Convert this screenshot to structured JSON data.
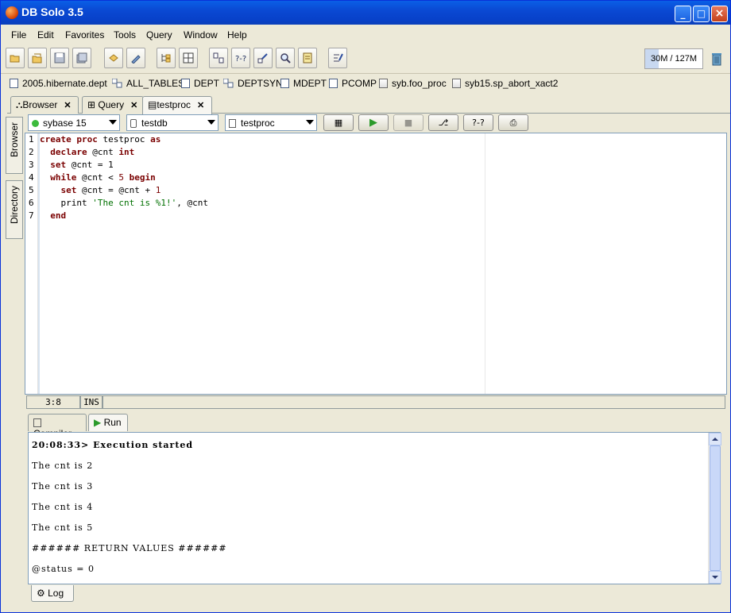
{
  "window": {
    "title": "DB Solo  3.5"
  },
  "menu": [
    "File",
    "Edit",
    "Favorites",
    "Tools",
    "Query",
    "Window",
    "Help"
  ],
  "memory": {
    "label": "30M / 127M",
    "used_fraction": 0.24
  },
  "favorites": [
    {
      "label": "2005.hibernate.dept",
      "icon": "table-icon"
    },
    {
      "label": "ALL_TABLES",
      "icon": "synonym-icon"
    },
    {
      "label": "DEPT",
      "icon": "table-icon"
    },
    {
      "label": "DEPTSYN",
      "icon": "synonym-icon"
    },
    {
      "label": "MDEPT",
      "icon": "table-icon"
    },
    {
      "label": "PCOMP",
      "icon": "table-icon"
    },
    {
      "label": "syb.foo_proc",
      "icon": "procedure-icon"
    },
    {
      "label": "syb15.sp_abort_xact2",
      "icon": "procedure-icon"
    }
  ],
  "tabs": [
    {
      "label": "Browser",
      "icon": "browser-icon"
    },
    {
      "label": "Query",
      "icon": "grid-icon"
    },
    {
      "label": "testproc",
      "icon": "procedure-icon",
      "active": true
    }
  ],
  "sidebar": {
    "browser": "Browser",
    "directory": "Directory"
  },
  "editor_toolbar": {
    "server": "sybase 15",
    "database": "testdb",
    "object": "testproc"
  },
  "editor": {
    "line_numbers": [
      "1",
      "2",
      "3",
      "4",
      "5",
      "6",
      "7"
    ]
  },
  "status": {
    "position": "3:8",
    "mode": "INS"
  },
  "bottom_tabs": {
    "compiler": "Compiler",
    "run": "Run"
  },
  "output": [
    "20:08:33> Execution started",
    "The cnt is 2",
    "The cnt is 3",
    "The cnt is 4",
    "The cnt is 5",
    "###### RETURN VALUES ######",
    "@status = 0"
  ],
  "log_tab": "Log"
}
